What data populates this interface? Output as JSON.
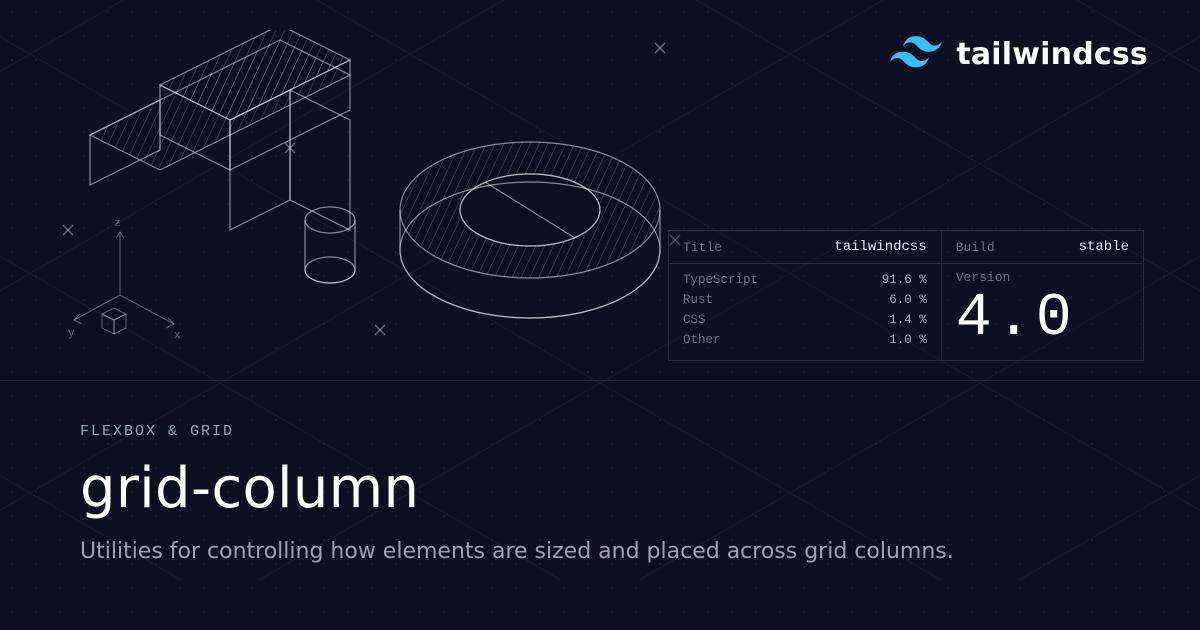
{
  "brand": {
    "name": "tailwindcss"
  },
  "axes": {
    "x": "x",
    "y": "y",
    "z": "z"
  },
  "info": {
    "title_label": "Title",
    "title_value": "tailwindcss",
    "build_label": "Build",
    "build_value": "stable",
    "version_label": "Version",
    "version_value": "4.0",
    "languages": [
      {
        "name": "TypeScript",
        "pct": "91.6 %"
      },
      {
        "name": "Rust",
        "pct": "6.0 %"
      },
      {
        "name": "CSS",
        "pct": "1.4 %"
      },
      {
        "name": "Other",
        "pct": "1.0 %"
      }
    ]
  },
  "page": {
    "eyebrow": "FLEXBOX & GRID",
    "title": "grid-column",
    "subtitle": "Utilities for controlling how elements are sized and placed across grid columns."
  }
}
